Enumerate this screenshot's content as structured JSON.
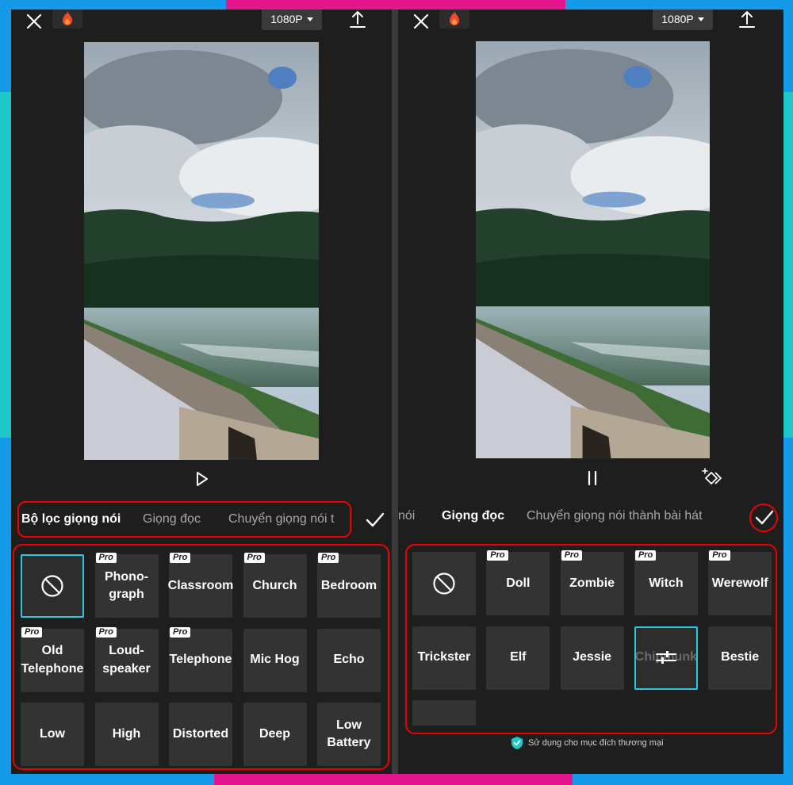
{
  "topbar": {
    "resolution": "1080P"
  },
  "left_panel": {
    "tabs": [
      {
        "label": "Bộ lọc giọng nói",
        "active": true
      },
      {
        "label": "Giọng đọc",
        "active": false
      },
      {
        "label": "Chuyển giọng nói t",
        "active": false
      }
    ],
    "tiles": [
      {
        "label": "",
        "pro": false,
        "icon": "none-icon",
        "selected": true
      },
      {
        "label": "Phono-\ngraph",
        "pro": true
      },
      {
        "label": "Classroom",
        "pro": true
      },
      {
        "label": "Church",
        "pro": true
      },
      {
        "label": "Bedroom",
        "pro": true
      },
      {
        "label": "Old\nTelephone",
        "pro": true
      },
      {
        "label": "Loud-\nspeaker",
        "pro": true
      },
      {
        "label": "Telephone",
        "pro": true
      },
      {
        "label": "Mic Hog",
        "pro": false
      },
      {
        "label": "Echo",
        "pro": false
      },
      {
        "label": "Low",
        "pro": false
      },
      {
        "label": "High",
        "pro": false
      },
      {
        "label": "Distorted",
        "pro": false
      },
      {
        "label": "Deep",
        "pro": false
      },
      {
        "label": "Low\nBattery",
        "pro": false
      }
    ]
  },
  "right_panel": {
    "tabs": [
      {
        "label": "nói",
        "active": false
      },
      {
        "label": "Giọng đọc",
        "active": true
      },
      {
        "label": "Chuyển giọng nói thành bài hát",
        "active": false
      }
    ],
    "tiles": [
      {
        "label": "",
        "pro": false,
        "icon": "none-icon"
      },
      {
        "label": "Doll",
        "pro": true
      },
      {
        "label": "Zombie",
        "pro": true
      },
      {
        "label": "Witch",
        "pro": true
      },
      {
        "label": "Werewolf",
        "pro": true
      },
      {
        "label": "Trickster",
        "pro": false
      },
      {
        "label": "Elf",
        "pro": false
      },
      {
        "label": "Jessie",
        "pro": false
      },
      {
        "label": "Chipmunk",
        "pro": false,
        "selected": true,
        "icon": "adjust-icon"
      },
      {
        "label": "Bestie",
        "pro": false
      },
      {
        "label": "",
        "pro": false
      }
    ],
    "commercial_note": "Sử dụng cho mục đích thương mại"
  },
  "badge_text": "Pro",
  "colors": {
    "accent": "#29c8e0",
    "highlight": "#e00000",
    "pink": "#e3168e",
    "blue": "#149ae8",
    "teal": "#1fc8c8"
  }
}
